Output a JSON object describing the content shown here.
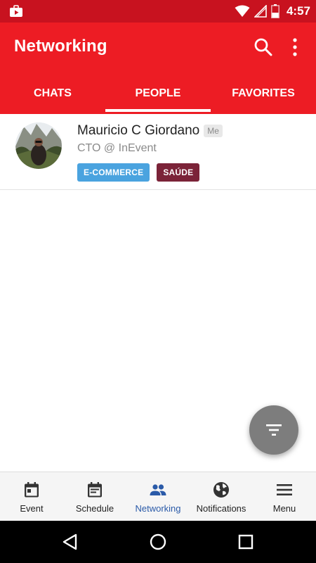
{
  "status_bar": {
    "time": "4:57"
  },
  "app_bar": {
    "title": "Networking"
  },
  "tabs": [
    {
      "label": "CHATS",
      "selected": false
    },
    {
      "label": "PEOPLE",
      "selected": true
    },
    {
      "label": "FAVORITES",
      "selected": false
    }
  ],
  "people": [
    {
      "name": "Mauricio C Giordano",
      "badge": "Me",
      "role": "CTO @ InEvent",
      "tags": [
        {
          "label": "E-COMMERCE",
          "color": "#4aa3df"
        },
        {
          "label": "SAÚDE",
          "color": "#7b2338"
        }
      ]
    }
  ],
  "bottom_nav": [
    {
      "label": "Event",
      "icon": "calendar-icon",
      "active": false
    },
    {
      "label": "Schedule",
      "icon": "schedule-icon",
      "active": false
    },
    {
      "label": "Networking",
      "icon": "people-icon",
      "active": true
    },
    {
      "label": "Notifications",
      "icon": "globe-icon",
      "active": false
    },
    {
      "label": "Menu",
      "icon": "hamburger-menu-icon",
      "active": false
    }
  ],
  "colors": {
    "status_bar": "#c8121f",
    "app_bar": "#ed1c24",
    "active_nav": "#2a5aa8",
    "fab": "#7d7d7d"
  }
}
